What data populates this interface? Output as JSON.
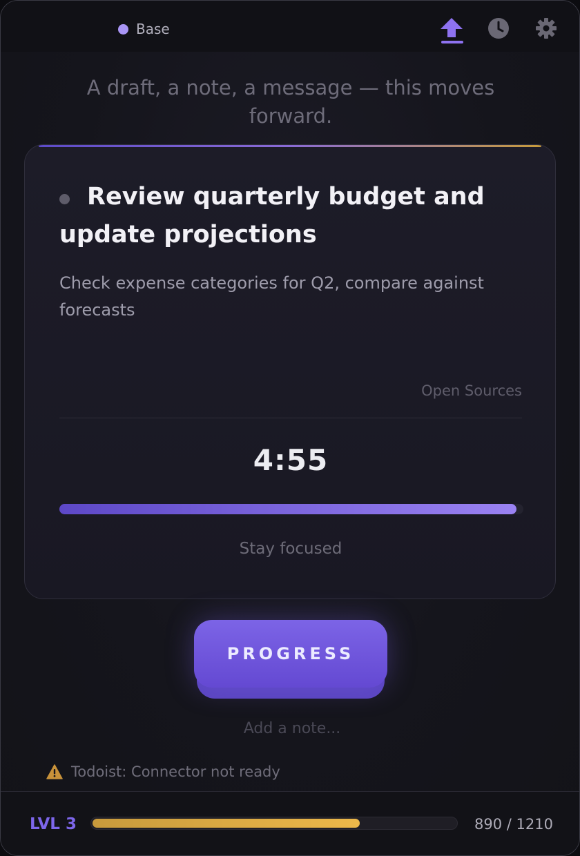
{
  "header": {
    "mode_label": "Base",
    "mode_color": "#a995f5",
    "icons": [
      "upload-icon",
      "history-icon",
      "settings-icon"
    ]
  },
  "tagline": "A draft, a note, a message — this moves forward.",
  "task": {
    "title": "Review quarterly budget and update projections",
    "description": "Check expense categories for Q2, compare against forecasts",
    "open_sources_label": "Open Sources"
  },
  "timer": {
    "display": "4:55",
    "progress": 0.985,
    "caption": "Stay focused"
  },
  "actions": {
    "progress_label": "PROGRESS",
    "note_placeholder": "Add a note..."
  },
  "warning": {
    "icon": "warning-icon",
    "text": "Todoist: Connector not ready"
  },
  "footer": {
    "level_label": "LVL 3",
    "xp_current": 890,
    "xp_max": 1210,
    "xp_text": "890 / 1210"
  },
  "colors": {
    "accent": "#7d66ea",
    "xp_bar": "#ecb84a",
    "warning": "#c8923a"
  }
}
